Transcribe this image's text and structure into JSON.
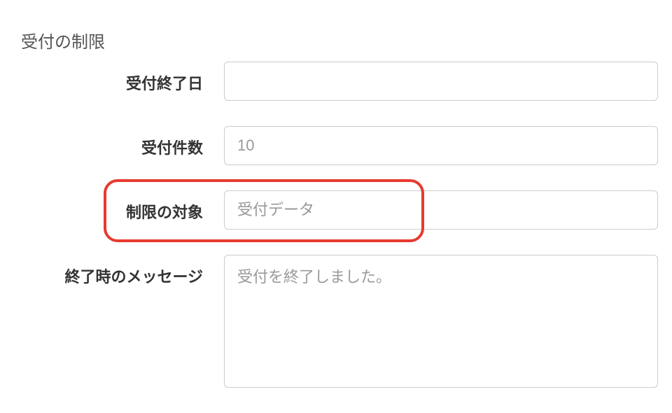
{
  "section": {
    "title": "受付の制限"
  },
  "fields": {
    "end_date": {
      "label": "受付終了日",
      "value": "",
      "placeholder": ""
    },
    "count": {
      "label": "受付件数",
      "value": "",
      "placeholder": "10"
    },
    "target": {
      "label": "制限の対象",
      "value": "",
      "placeholder": "受付データ"
    },
    "end_message": {
      "label": "終了時のメッセージ",
      "value": "",
      "placeholder": "受付を終了しました。"
    }
  }
}
